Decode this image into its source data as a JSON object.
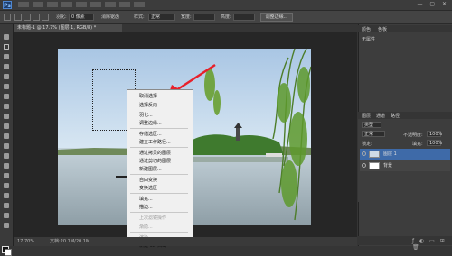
{
  "app": {
    "logo_text": "Ps"
  },
  "options_bar": {
    "feather_label": "羽化:",
    "feather_value": "0 像素",
    "antialias_label": "消除锯齿",
    "style_label": "样式:",
    "style_value": "正常",
    "width_label": "宽度:",
    "height_label": "高度:",
    "refine_edge_button": "调整边缘..."
  },
  "document": {
    "tab_title": "未标题-1 @ 17.7% (图层 1, RGB/8) *",
    "status_zoom": "17.70%",
    "status_doc": "文档:20.1M/20.1M"
  },
  "context_menu": {
    "items": [
      {
        "label": "取消选择",
        "enabled": true
      },
      {
        "label": "选择反向",
        "enabled": true
      },
      {
        "label": "羽化...",
        "enabled": true
      },
      {
        "label": "调整边缘...",
        "enabled": true
      },
      {
        "label": "存储选区...",
        "enabled": true
      },
      {
        "label": "建立工作路径...",
        "enabled": true
      },
      {
        "label": "通过拷贝的图层",
        "enabled": true
      },
      {
        "label": "通过剪切的图层",
        "enabled": true
      },
      {
        "label": "新建图层...",
        "enabled": true
      },
      {
        "label": "自由变换",
        "enabled": true
      },
      {
        "label": "变换选区",
        "enabled": true
      },
      {
        "label": "填充...",
        "enabled": true
      },
      {
        "label": "描边...",
        "enabled": true
      },
      {
        "label": "上次滤镜操作",
        "enabled": false
      },
      {
        "label": "渐隐...",
        "enabled": false
      },
      {
        "label": "渲染",
        "enabled": false
      },
      {
        "label": "新建 3D 凸出",
        "enabled": true
      }
    ]
  },
  "right_panel": {
    "top_tabs": [
      "颜色",
      "色板"
    ],
    "top_panel_label": "无属性",
    "layers_tabs": [
      "图层",
      "通道",
      "路径"
    ],
    "kind_label": "类型",
    "blend_mode": "正常",
    "opacity_label": "不透明度:",
    "opacity_value": "100%",
    "lock_label": "锁定:",
    "fill_label": "填充:",
    "fill_value": "100%",
    "layers": [
      {
        "name": "图层 1",
        "selected": true
      },
      {
        "name": "背景",
        "selected": false
      }
    ]
  },
  "colors": {
    "accent_arrow": "#e8202a",
    "selected_layer": "#3e6aa8"
  }
}
